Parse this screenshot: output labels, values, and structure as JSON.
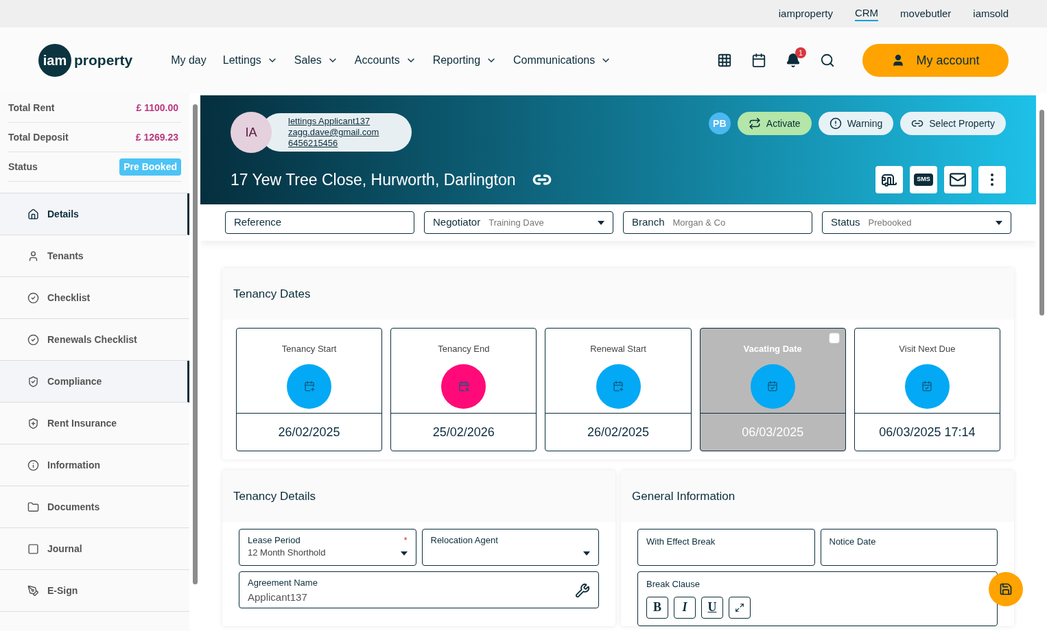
{
  "brand_links": [
    {
      "label": "iamproperty",
      "selected": false
    },
    {
      "label": "CRM",
      "selected": true
    },
    {
      "label": "movebutler",
      "selected": false
    },
    {
      "label": "iamsold",
      "selected": false
    }
  ],
  "logo": {
    "mark": "iam",
    "word": "property"
  },
  "nav": [
    {
      "label": "My day",
      "dropdown": false
    },
    {
      "label": "Lettings",
      "dropdown": true
    },
    {
      "label": "Sales",
      "dropdown": true
    },
    {
      "label": "Accounts",
      "dropdown": true
    },
    {
      "label": "Reporting",
      "dropdown": true
    },
    {
      "label": "Communications",
      "dropdown": true
    }
  ],
  "notifications": "1",
  "account_button": "My account",
  "summary": [
    {
      "label": "Total Rent",
      "value": "£ 1100.00",
      "kind": "amount"
    },
    {
      "label": "Total Deposit",
      "value": "£ 1269.23",
      "kind": "amount"
    },
    {
      "label": "Status",
      "value": "Pre Booked",
      "kind": "badge"
    }
  ],
  "sidebar": [
    {
      "label": "Details",
      "selected": true,
      "highlighted": true
    },
    {
      "label": "Tenants",
      "selected": false,
      "highlighted": false
    },
    {
      "label": "Checklist",
      "selected": false,
      "highlighted": false
    },
    {
      "label": "Renewals Checklist",
      "selected": false,
      "highlighted": false
    },
    {
      "label": "Compliance",
      "selected": false,
      "highlighted": true
    },
    {
      "label": "Rent Insurance",
      "selected": false,
      "highlighted": false
    },
    {
      "label": "Information",
      "selected": false,
      "highlighted": false
    },
    {
      "label": "Documents",
      "selected": false,
      "highlighted": false
    },
    {
      "label": "Journal",
      "selected": false,
      "highlighted": false
    },
    {
      "label": "E-Sign",
      "selected": false,
      "highlighted": false
    }
  ],
  "applicant": {
    "initials": "IA",
    "name": "lettings Applicant137",
    "email": "zagg.dave@gmail.com",
    "phone": "6456215456"
  },
  "address": "17 Yew Tree Close, Hurworth, Darlington",
  "status_avatar": "PB",
  "header_buttons": [
    {
      "label": "Activate",
      "kind": "activate"
    },
    {
      "label": "Warning",
      "kind": "warning"
    },
    {
      "label": "Select Property",
      "kind": "link"
    }
  ],
  "actions": [
    {
      "kind": "letter"
    },
    {
      "kind": "sms",
      "label": "SMS"
    },
    {
      "kind": "email"
    },
    {
      "kind": "more"
    }
  ],
  "filters": [
    {
      "label": "Reference",
      "kind": "text"
    },
    {
      "label": "Negotiator",
      "value": "Training Dave",
      "kind": "select"
    },
    {
      "label": "Branch",
      "value": "Morgan & Co",
      "kind": "text"
    },
    {
      "label": "Status",
      "value": "Prebooked",
      "kind": "select"
    }
  ],
  "tenancy_dates": {
    "title": "Tenancy Dates",
    "items": [
      {
        "label": "Tenancy Start",
        "date": "26/02/2025",
        "color": "#03a9f4",
        "kind": "plain"
      },
      {
        "label": "Tenancy End",
        "date": "25/02/2026",
        "color": "#ff0a78",
        "kind": "plain"
      },
      {
        "label": "Renewal Start",
        "date": "26/02/2025",
        "color": "#03a9f4",
        "kind": "plain"
      },
      {
        "label": "Vacating Date",
        "date": "06/03/2025",
        "color": "#03a9f4",
        "kind": "checkable",
        "checked": false
      },
      {
        "label": "Visit Next Due",
        "date": "06/03/2025 17:14",
        "color": "#03a9f4",
        "kind": "plain"
      }
    ]
  },
  "tenancy_details": {
    "title": "Tenancy Details",
    "fields": [
      {
        "label": "Lease Period",
        "value": "12 Month Shorthold",
        "required_mark": "*",
        "kind": "select"
      },
      {
        "label": "Relocation Agent",
        "kind": "select"
      },
      {
        "label": "Agreement Name",
        "value": "Applicant137",
        "kind": "tool"
      }
    ]
  },
  "general_information": {
    "title": "General Information",
    "fields": [
      {
        "label": "With Effect Break"
      },
      {
        "label": "Notice Date"
      }
    ],
    "editor": {
      "label": "Break Clause",
      "tools": [
        {
          "label": "B",
          "kind": "bold"
        },
        {
          "label": "I",
          "kind": "italic"
        },
        {
          "label": "U",
          "kind": "underline"
        },
        {
          "kind": "expand"
        }
      ]
    }
  }
}
